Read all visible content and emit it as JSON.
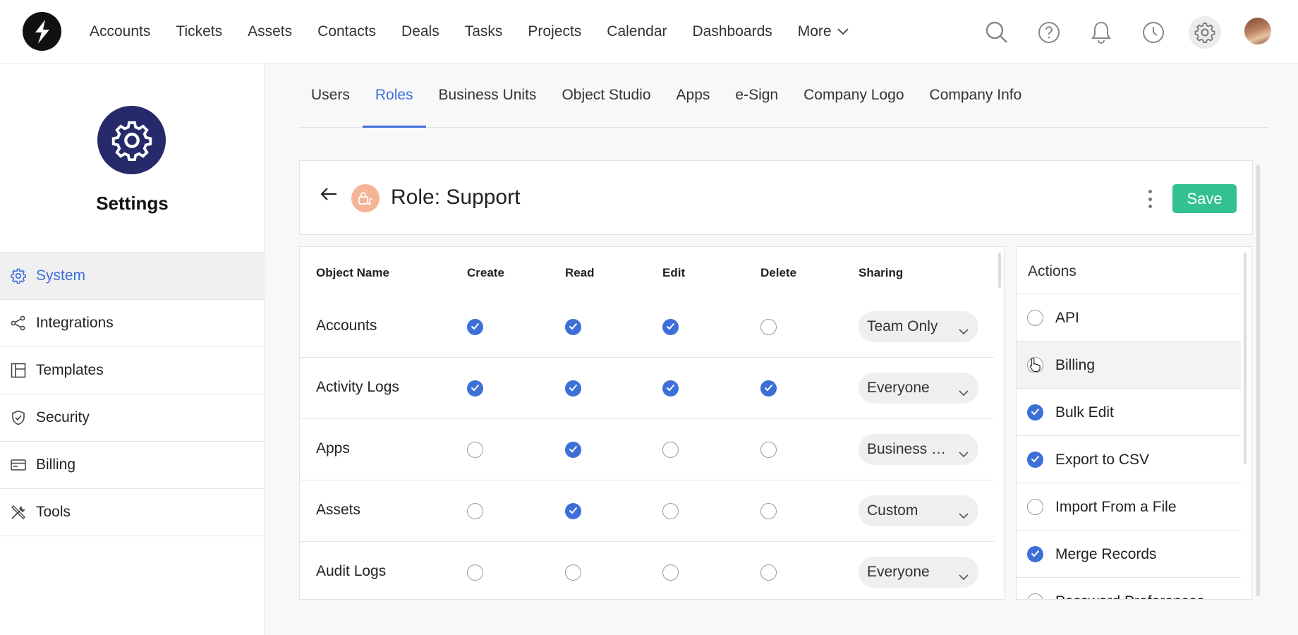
{
  "topnav": {
    "items": [
      "Accounts",
      "Tickets",
      "Assets",
      "Contacts",
      "Deals",
      "Tasks",
      "Projects",
      "Calendar",
      "Dashboards"
    ],
    "more_label": "More"
  },
  "top_icons": [
    "search-icon",
    "help-icon",
    "bell-icon",
    "clock-icon",
    "gear-icon"
  ],
  "sidebar": {
    "title": "Settings",
    "items": [
      {
        "label": "System",
        "icon": "gear-icon",
        "active": true
      },
      {
        "label": "Integrations",
        "icon": "share-icon",
        "active": false
      },
      {
        "label": "Templates",
        "icon": "layout-icon",
        "active": false
      },
      {
        "label": "Security",
        "icon": "shield-icon",
        "active": false
      },
      {
        "label": "Billing",
        "icon": "card-icon",
        "active": false
      },
      {
        "label": "Tools",
        "icon": "tools-icon",
        "active": false
      }
    ]
  },
  "tabs": [
    {
      "label": "Users",
      "active": false
    },
    {
      "label": "Roles",
      "active": true
    },
    {
      "label": "Business Units",
      "active": false
    },
    {
      "label": "Object Studio",
      "active": false
    },
    {
      "label": "Apps",
      "active": false
    },
    {
      "label": "e-Sign",
      "active": false
    },
    {
      "label": "Company Logo",
      "active": false
    },
    {
      "label": "Company Info",
      "active": false
    }
  ],
  "role": {
    "title": "Role: Support",
    "save_label": "Save"
  },
  "permissions": {
    "headers": {
      "object": "Object Name",
      "create": "Create",
      "read": "Read",
      "edit": "Edit",
      "delete": "Delete",
      "sharing": "Sharing"
    },
    "rows": [
      {
        "name": "Accounts",
        "create": true,
        "read": true,
        "edit": true,
        "delete": false,
        "sharing": "Team Only"
      },
      {
        "name": "Activity Logs",
        "create": true,
        "read": true,
        "edit": true,
        "delete": true,
        "sharing": "Everyone"
      },
      {
        "name": "Apps",
        "create": false,
        "read": true,
        "edit": false,
        "delete": false,
        "sharing": "Business Unit"
      },
      {
        "name": "Assets",
        "create": false,
        "read": true,
        "edit": false,
        "delete": false,
        "sharing": "Custom"
      },
      {
        "name": "Audit Logs",
        "create": false,
        "read": false,
        "edit": false,
        "delete": false,
        "sharing": "Everyone"
      }
    ]
  },
  "actions": {
    "title": "Actions",
    "items": [
      {
        "label": "API",
        "checked": false
      },
      {
        "label": "Billing",
        "checked": false
      },
      {
        "label": "Bulk Edit",
        "checked": true
      },
      {
        "label": "Export to CSV",
        "checked": true
      },
      {
        "label": "Import From a File",
        "checked": false
      },
      {
        "label": "Merge Records",
        "checked": true
      },
      {
        "label": "Password Preferences",
        "checked": false
      }
    ]
  },
  "colors": {
    "accent": "#3d6fd8",
    "save": "#33c28f",
    "settings_badge": "#262a6b",
    "role_icon": "#f6b497"
  }
}
